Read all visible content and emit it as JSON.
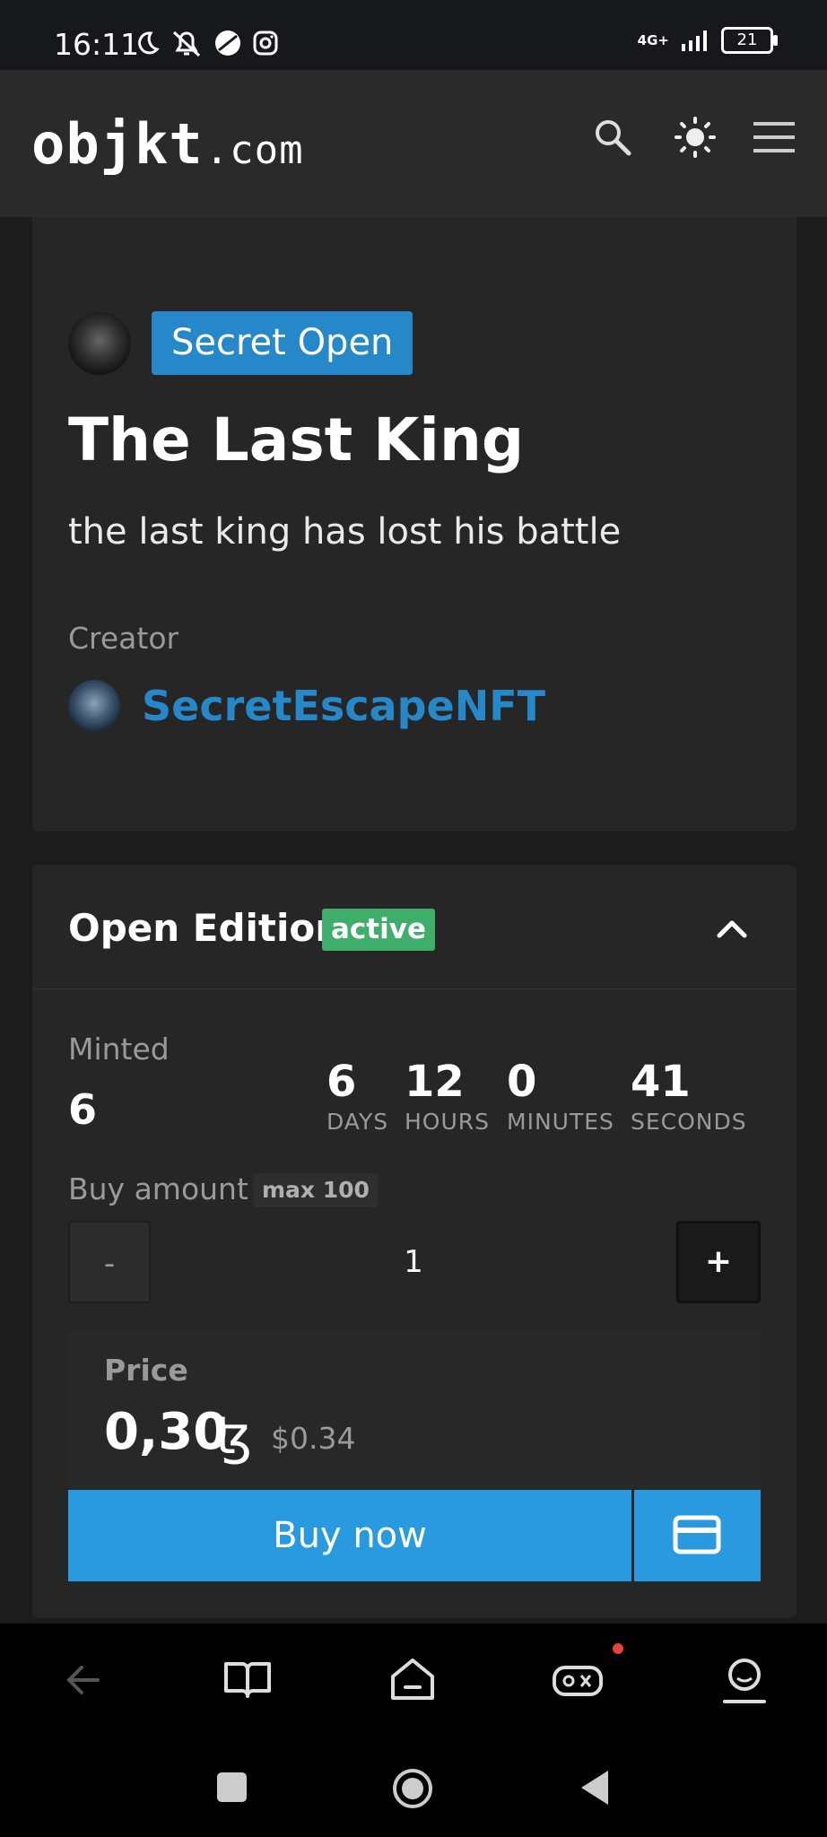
{
  "status_bar": {
    "time": "16:11",
    "network": "4G+",
    "battery": "21"
  },
  "header": {
    "logo_main": "objkt",
    "logo_domain": ".com",
    "icons": [
      "search-icon",
      "theme-sun-icon",
      "menu-icon"
    ]
  },
  "token": {
    "badge": "Secret Open",
    "title": "The Last King",
    "description": "the last king has lost his battle",
    "creator_label": "Creator",
    "creator_name": "SecretEscapeNFT"
  },
  "open_edition": {
    "title": "Open Edition",
    "status": "active",
    "minted_label": "Minted",
    "minted_value": "6",
    "countdown": {
      "days": "6",
      "days_label": "DAYS",
      "hours": "12",
      "hours_label": "HOURS",
      "minutes": "0",
      "minutes_label": "MINUTES",
      "seconds": "41",
      "seconds_label": "SECONDS"
    },
    "buy_amount_label": "Buy amount",
    "max_label": "max 100",
    "minus_label": "-",
    "quantity": "1",
    "plus_label": "+",
    "price_label": "Price",
    "price_value": "0,30",
    "currency_symbol": "ꜩ",
    "price_usd": "$0.34",
    "buy_button": "Buy now"
  },
  "bottom_nav": [
    "back-arrow-icon",
    "book-icon",
    "home-icon",
    "game-icon",
    "profile-icon"
  ],
  "system_nav": [
    "recents-icon",
    "home-circle-icon",
    "back-triangle-icon"
  ],
  "colors": {
    "accent": "#2688c8",
    "button": "#2a9ae0",
    "active": "#3fae6a",
    "card": "#262626",
    "background": "#1c1c1c"
  }
}
